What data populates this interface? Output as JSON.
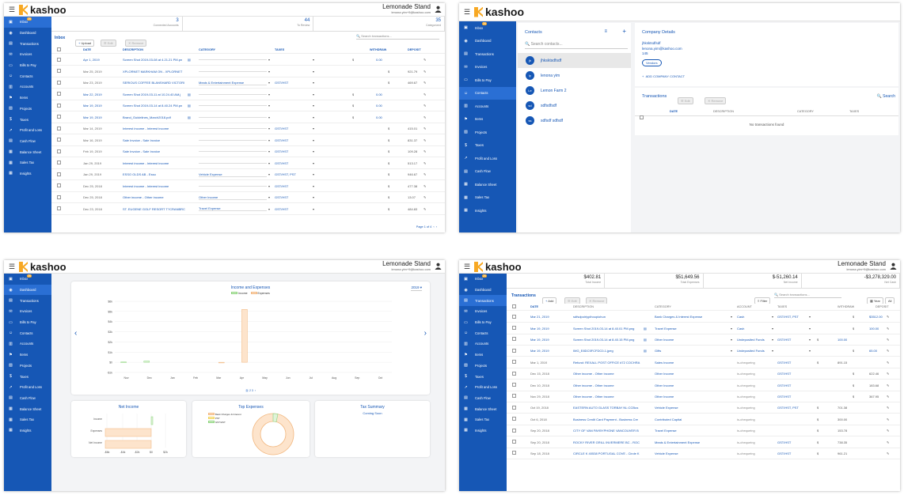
{
  "company": {
    "name": "Lemonade Stand",
    "email": "lenona.yim+9@kashoo.com"
  },
  "logo": "kashoo",
  "nav": [
    "Inbox",
    "Dashboard",
    "Transactions",
    "Invoices",
    "Bills to Pay",
    "Contacts",
    "Accounts",
    "Items",
    "Projects",
    "Taxes",
    "Profit and Loss",
    "Cash Flow",
    "Balance Sheet",
    "Sales Tax",
    "Insights"
  ],
  "nav_icons": [
    "inbox-icon",
    "dashboard-icon",
    "transactions-icon",
    "invoices-icon",
    "bills-icon",
    "contacts-icon",
    "accounts-icon",
    "items-icon",
    "projects-icon",
    "taxes-icon",
    "profit-icon",
    "cashflow-icon",
    "balance-icon",
    "salestax-icon",
    "insights-icon"
  ],
  "inbox_badge": "26",
  "p1": {
    "stats": [
      {
        "value": "3",
        "label": "Connected Accounts"
      },
      {
        "value": "44",
        "label": "To Review"
      },
      {
        "value": "35",
        "label": "Categorized"
      }
    ],
    "title": "Inbox",
    "upload": "Upload",
    "edit": "Edit",
    "remove": "Remove",
    "search_ph": "Search transactions...",
    "headers": [
      "DATE",
      "DESCRIPTION",
      "CATEGORY",
      "TAXES",
      "WITHDRAW",
      "DEPOSIT"
    ],
    "rows": [
      {
        "date": "Apr 1, 2019",
        "desc": "Screen Shot 2019-03-08 at 4.21.21 PM.pn",
        "cat": "",
        "tax": "",
        "amt": "0.00",
        "blue": true
      },
      {
        "date": "Mar 25, 2019",
        "desc": "XPLORNET MARKHAM ON - XPLORNET",
        "cat": "",
        "tax": "",
        "amt": "921.79",
        "blue": false
      },
      {
        "date": "Mar 23, 2019",
        "desc": "SERIOUS COFFEE BLANSHARD VICTORI",
        "cat": "Meals & Entertainment Expense",
        "tax": "GST/HST",
        "amt": "469.67",
        "blue": false
      },
      {
        "date": "Mar 22, 2019",
        "desc": "Screen Shot 2019-03-11 at 10.24.40 AM.j",
        "cat": "",
        "tax": "",
        "amt": "0.00",
        "blue": true
      },
      {
        "date": "Mar 19, 2019",
        "desc": "Screen Shot 2019-03-14 at 8.40.24 PM.pn",
        "cat": "",
        "tax": "",
        "amt": "0.00",
        "blue": true
      },
      {
        "date": "Mar 19, 2019",
        "desc": "Brand_Guidelines_March2018.pdf",
        "cat": "",
        "tax": "",
        "amt": "0.00",
        "blue": true
      },
      {
        "date": "Mar 14, 2019",
        "desc": "Interest income - Interest income",
        "cat": "",
        "tax": "GST/HST",
        "amt": "415.01",
        "blue": false
      },
      {
        "date": "Mar 16, 2019",
        "desc": "Sale Invoice - Sale Invoice",
        "cat": "",
        "tax": "GST/HST",
        "amt": "831.37",
        "blue": false
      },
      {
        "date": "Feb 19, 2019",
        "desc": "Sale Invoice - Sale Invoice",
        "cat": "",
        "tax": "GST/HST",
        "amt": "109.28",
        "blue": false
      },
      {
        "date": "Jan 29, 2019",
        "desc": "Interest income - Interest income",
        "cat": "",
        "tax": "GST/HST",
        "amt": "513.17",
        "blue": false
      },
      {
        "date": "Jan 29, 2019",
        "desc": "ESSO OLDS AB - Esso",
        "cat": "Vehicle Expense",
        "tax": "GST/HST, PST",
        "amt": "946.67",
        "blue": false
      },
      {
        "date": "Dec 25, 2018",
        "desc": "Interest income - Interest income",
        "cat": "",
        "tax": "GST/HST",
        "amt": "477.38",
        "blue": false
      },
      {
        "date": "Dec 25, 2018",
        "desc": "Other income - Other income",
        "cat": "Other Income",
        "tax": "GST/HST",
        "amt": "13.07",
        "blue": false
      },
      {
        "date": "Dec 23, 2018",
        "desc": "ST. EUGENE GOLF RESORT T?CRANBRC",
        "cat": "Travel Expense",
        "tax": "GST/HST",
        "amt": "484.83",
        "blue": false
      }
    ],
    "pager": "Page 1 of 4"
  },
  "p2": {
    "contacts_title": "Contacts",
    "search_ph": "Search contacts...",
    "contacts": [
      {
        "init": "jh",
        "name": "jhksktsdfsdf"
      },
      {
        "init": "ly",
        "name": "lenona yim"
      },
      {
        "init": "Le",
        "name": "Lemon Farm 2"
      },
      {
        "init": "sd",
        "name": "sdfsdfsdf"
      },
      {
        "init": "ss",
        "name": "sdfsdf sdfsdf"
      }
    ],
    "details_title": "Company Details",
    "details": [
      "jhksktsdfsdf",
      "lenona.yim@kashoo.com",
      "145"
    ],
    "vendors": "Vendors",
    "add_contact": "ADD COMPANY CONTACT",
    "tx_title": "Transactions",
    "edit": "Edit",
    "remove": "Remove",
    "search": "Search",
    "headers": [
      "DATE",
      "DESCRIPTION",
      "CATEGORY",
      "TAXES"
    ],
    "empty": "No transactions found"
  },
  "p3": {
    "chart_title": "Income and Expenses",
    "year": "2019",
    "legend": [
      "Income",
      "Expenses"
    ],
    "chart_data": {
      "type": "bar",
      "categories": [
        "Nov",
        "Dec",
        "Jan",
        "Feb",
        "Mar",
        "Apr",
        "May",
        "Jun",
        "Jul",
        "Aug",
        "Sep",
        "Oct"
      ],
      "series": [
        {
          "name": "Income",
          "values": [
            0.3,
            1.2,
            0,
            0,
            0,
            0,
            0,
            0,
            0,
            0,
            0,
            0
          ]
        },
        {
          "name": "Expenses",
          "values": [
            0,
            0,
            0,
            0,
            -0.5,
            52,
            0,
            0,
            0,
            0,
            0,
            0
          ]
        }
      ],
      "yticks": [
        "$6k",
        "$5k",
        "$4k",
        "$3k",
        "$2k",
        "$1k",
        "$0",
        "-$1k"
      ],
      "ylim": [
        -10,
        60
      ]
    },
    "net_title": "Net Income",
    "net_labels": [
      "Income",
      "Expenses",
      "Net Income"
    ],
    "net_xticks": [
      "-$6k",
      "-$4k",
      "-$2k",
      "$0",
      "$2k"
    ],
    "top_title": "Top Expenses",
    "top_legend": [
      "Bank Charges & Interest",
      "PST",
      "GST/HST"
    ],
    "tax_title": "Tax Summary",
    "tax_sub": "Coming Soon"
  },
  "p4": {
    "stats": [
      {
        "value": "$402.81",
        "label": "Total Income"
      },
      {
        "value": "$51,649.56",
        "label": "Total Expenses"
      },
      {
        "value": "$-51,260.14",
        "label": "Net Income"
      },
      {
        "value": "-$3,278,329.00",
        "label": "Net Cash"
      }
    ],
    "title": "Transactions",
    "add": "Add",
    "edit": "Edit",
    "remove": "Remove",
    "filter": "Filter",
    "search_ph": "Search transactions...",
    "year": "Year",
    "all": "All",
    "headers": [
      "DATE",
      "DESCRIPTION",
      "CATEGORY",
      "ACCOUNT",
      "TAXES",
      "WITHDRAW",
      "DEPOSIT"
    ],
    "rows": [
      {
        "date": "Mar 21, 2019",
        "desc": "sdfsdpoiriypihoupiohun",
        "cat": "Bank Charges & Interest Expense",
        "acc": "Cash",
        "tax": "GST/HST, PST",
        "w": "",
        "d": "$3512.00",
        "blue": true
      },
      {
        "date": "Mar 19, 2019",
        "desc": "Screen Shot 2019-03-14 at 8.40.01 PM.png",
        "cat": "Travel Expense",
        "acc": "Cash",
        "tax": "",
        "w": "",
        "d": "100.00",
        "blue": true
      },
      {
        "date": "Mar 19, 2019",
        "desc": "Screen Shot 2019-03-14 at 8.40.15 PM.png",
        "cat": "Other Income",
        "acc": "Undeposited Funds",
        "tax": "GST/HST",
        "w": "100.00",
        "d": "",
        "blue": true
      },
      {
        "date": "Mar 19, 2019",
        "desc": "IMG_E8DC5FCFDC0-1.jpeg",
        "cat": "Gifts",
        "acc": "Undeposited Funds",
        "tax": "",
        "w": "",
        "d": "65.00",
        "blue": true
      },
      {
        "date": "Mar 1, 2019",
        "desc": "Refund: REXALL POST OFFICE #72 COCHRA",
        "cat": "Sales Income",
        "acc": "is-chequeing",
        "tax": "GST/HST",
        "w": "891.15",
        "d": "",
        "blue": false
      },
      {
        "date": "Dec 15, 2018",
        "desc": "Other income - Other income",
        "cat": "Other Income",
        "acc": "is-chequeing",
        "tax": "GST/HST",
        "w": "",
        "d": "622.46",
        "blue": false
      },
      {
        "date": "Dec 10, 2018",
        "desc": "Other income - Other income",
        "cat": "Other Income",
        "acc": "is-chequeing",
        "tax": "GST/HST",
        "w": "",
        "d": "183.68",
        "blue": false
      },
      {
        "date": "Nov 29, 2018",
        "desc": "Other income - Other income",
        "cat": "Other Income",
        "acc": "is-chequeing",
        "tax": "GST/HST",
        "w": "",
        "d": "367.95",
        "blue": false
      },
      {
        "date": "Oct 19, 2018",
        "desc": "EASTERN AUTO GLASS TORBAY NL:CCBus",
        "cat": "Vehicle Expense",
        "acc": "is-chequeing",
        "tax": "GST/HST, PST",
        "w": "701.38",
        "d": "",
        "blue": false
      },
      {
        "date": "Oct 6, 2018",
        "desc": "Business Credit Card Payment - Business Cre",
        "cat": "Contributed Capital",
        "acc": "is-chequeing",
        "tax": "",
        "w": "300.00",
        "d": "",
        "blue": false
      },
      {
        "date": "Sep 20, 2018",
        "desc": "CITY OF VAN PAYBYPHONE VANCOUVER B",
        "cat": "Travel Expense",
        "acc": "is-chequeing",
        "tax": "",
        "w": "153.78",
        "d": "",
        "blue": false
      },
      {
        "date": "Sep 20, 2018",
        "desc": "ROCKY RIVER GRILL INVERMERE BC - ROC",
        "cat": "Meals & Entertainment Expense",
        "acc": "is-chequeing",
        "tax": "GST/HST",
        "w": "738.35",
        "d": "",
        "blue": false
      },
      {
        "date": "Sep 18, 2018",
        "desc": "CIRCLE K 40538 PORTUGAL COVE - Circle K",
        "cat": "Vehicle Expense",
        "acc": "is-chequeing",
        "tax": "GST/HST",
        "w": "961.21",
        "d": "",
        "blue": false
      }
    ]
  }
}
